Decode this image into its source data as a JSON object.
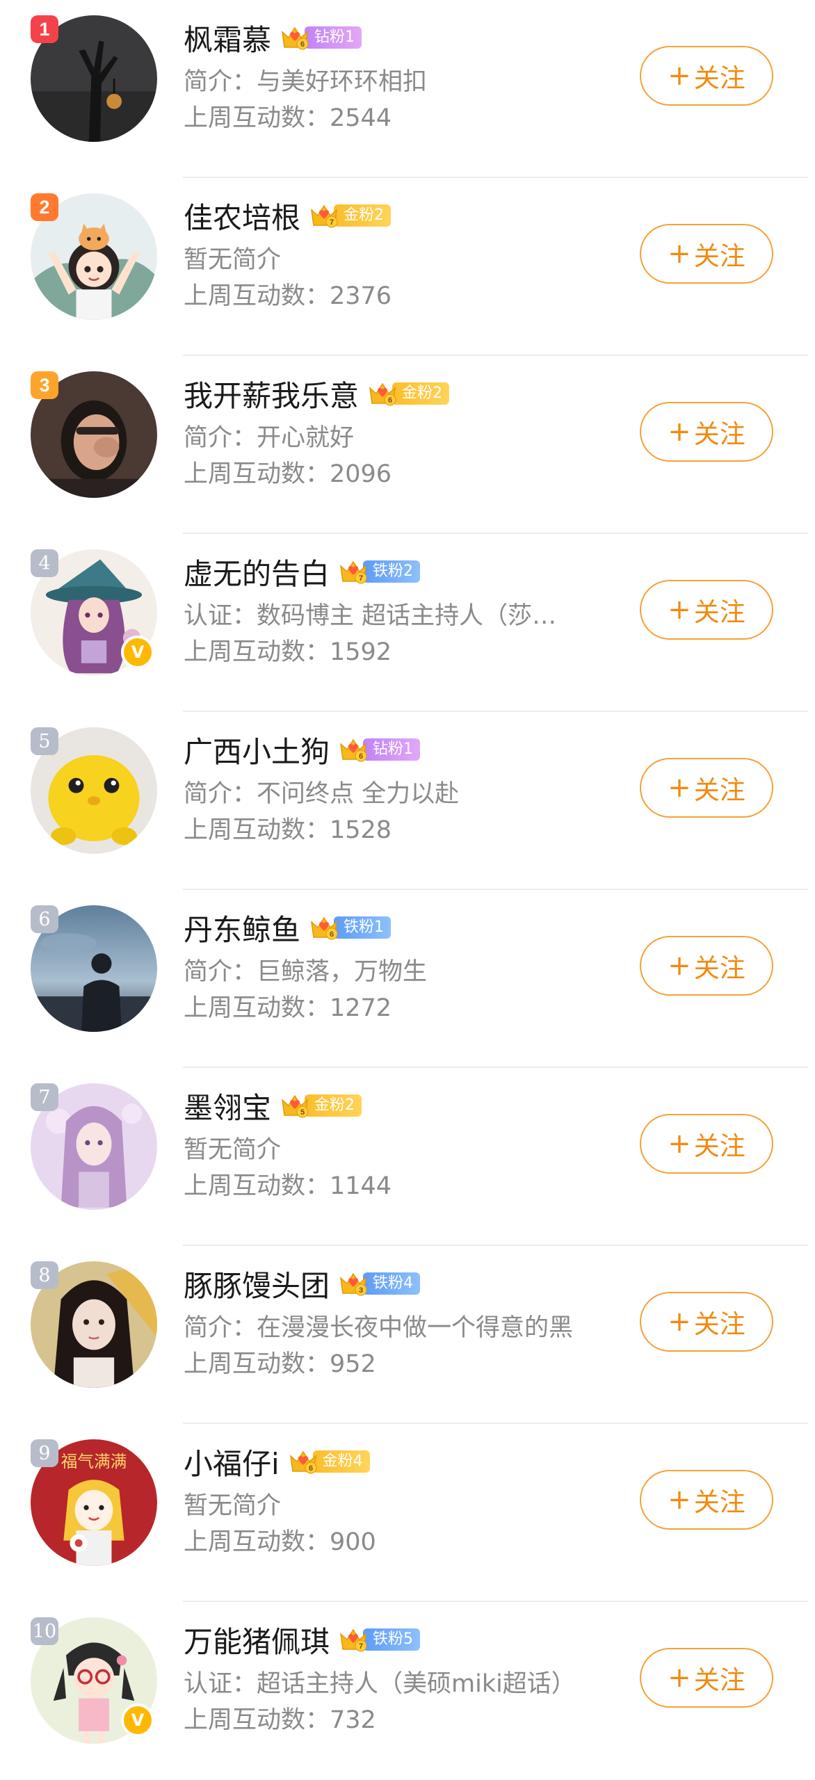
{
  "users": [
    {
      "rank": "1",
      "name": "枫霜慕",
      "badge_level": "6",
      "badge_label": "钻粉1",
      "badge_type": "diamond",
      "bio": "简介：与美好环环相扣",
      "stat": "上周互动数：2544",
      "verified": false,
      "follow_label": "关注",
      "follow_icon": "+"
    },
    {
      "rank": "2",
      "name": "佳农培根",
      "badge_level": "7",
      "badge_label": "金粉2",
      "badge_type": "gold",
      "bio": "暂无简介",
      "stat": "上周互动数：2376",
      "verified": false,
      "follow_label": "关注",
      "follow_icon": "+"
    },
    {
      "rank": "3",
      "name": "我开薪我乐意",
      "badge_level": "6",
      "badge_label": "金粉2",
      "badge_type": "gold",
      "bio": "简介：开心就好",
      "stat": "上周互动数：2096",
      "verified": false,
      "follow_label": "关注",
      "follow_icon": "+"
    },
    {
      "rank": "4",
      "name": "虚无的告白",
      "badge_level": "7",
      "badge_label": "铁粉2",
      "badge_type": "iron",
      "bio": "认证：数码博主 超话主持人（莎…",
      "stat": "上周互动数：1592",
      "verified": true,
      "follow_label": "关注",
      "follow_icon": "+"
    },
    {
      "rank": "5",
      "name": "广西小土狗",
      "badge_level": "6",
      "badge_label": "钻粉1",
      "badge_type": "diamond",
      "bio": "简介：不问终点 全力以赴",
      "stat": "上周互动数：1528",
      "verified": false,
      "follow_label": "关注",
      "follow_icon": "+"
    },
    {
      "rank": "6",
      "name": "丹东鲸鱼",
      "badge_level": "6",
      "badge_label": "铁粉1",
      "badge_type": "iron",
      "bio": "简介：巨鲸落，万物生",
      "stat": "上周互动数：1272",
      "verified": false,
      "follow_label": "关注",
      "follow_icon": "+"
    },
    {
      "rank": "7",
      "name": "墨翎宝",
      "badge_level": "5",
      "badge_label": "金粉2",
      "badge_type": "gold",
      "bio": "暂无简介",
      "stat": "上周互动数：1144",
      "verified": false,
      "follow_label": "关注",
      "follow_icon": "+"
    },
    {
      "rank": "8",
      "name": "豚豚馒头团",
      "badge_level": "3",
      "badge_label": "铁粉4",
      "badge_type": "iron",
      "bio": "简介：在漫漫长夜中做一个得意的黑",
      "stat": "上周互动数：952",
      "verified": false,
      "follow_label": "关注",
      "follow_icon": "+"
    },
    {
      "rank": "9",
      "name": "小福仔i",
      "badge_level": "6",
      "badge_label": "金粉4",
      "badge_type": "gold",
      "bio": "暂无简介",
      "stat": "上周互动数：900",
      "verified": false,
      "follow_label": "关注",
      "follow_icon": "+"
    },
    {
      "rank": "10",
      "name": "万能猪佩琪",
      "badge_level": "7",
      "badge_label": "铁粉5",
      "badge_type": "iron",
      "bio": "认证：超话主持人（美硕miki超话）",
      "stat": "上周互动数：732",
      "verified": true,
      "follow_label": "关注",
      "follow_icon": "+"
    }
  ],
  "avatar_text_9": "福气满满",
  "verified_icon_text": "V",
  "colors": {
    "follow_accent": "#f28a12",
    "rank_1": "#f5424a",
    "rank_2": "#ff7a2e",
    "rank_3": "#ffa42b",
    "rank_other": "#b7bccb",
    "verified": "#ffb800"
  }
}
